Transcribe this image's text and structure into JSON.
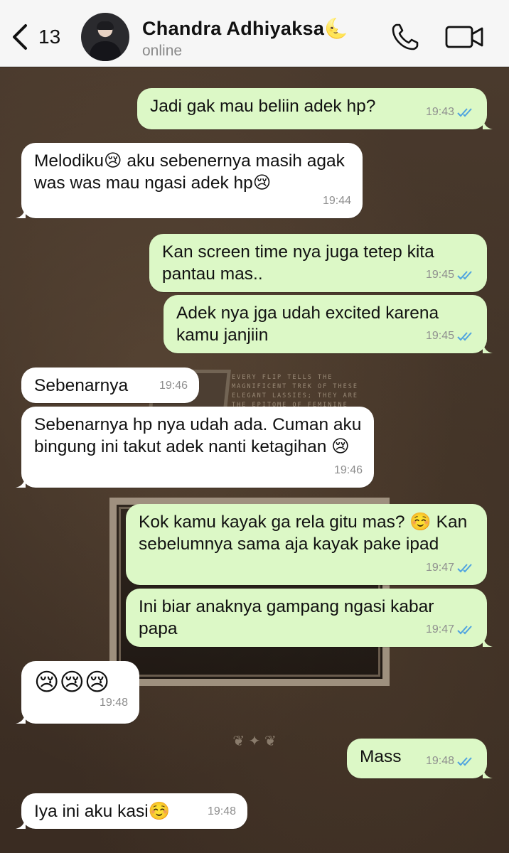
{
  "header": {
    "back_count": "13",
    "contact_name": "Chandra Adhiyaksa🌜",
    "contact_status": "online"
  },
  "wallpaper": {
    "text": "EVERY FLIP TELLS THE MAGNIFICENT TREK OF THESE ELEGANT LASSIES; THEY ARE THE EPITOME OF FEMININE"
  },
  "messages": [
    {
      "dir": "out",
      "text": "Jadi gak mau beliin adek hp?",
      "time": "19:43",
      "read": true
    },
    {
      "dir": "in",
      "text": "Melodiku😢 aku sebenernya masih agak was was mau ngasi adek hp😢",
      "time": "19:44"
    },
    {
      "dir": "out",
      "text": "Kan screen time nya juga tetep kita pantau mas..",
      "time": "19:45",
      "read": true
    },
    {
      "dir": "out",
      "text": "Adek nya jga udah excited karena kamu janjiin",
      "time": "19:45",
      "read": true
    },
    {
      "dir": "in",
      "text": "Sebenarnya",
      "time": "19:46"
    },
    {
      "dir": "in",
      "text": "Sebenarnya hp nya udah ada. Cuman aku bingung ini takut adek nanti ketagihan 😢",
      "time": "19:46"
    },
    {
      "dir": "out",
      "text": "Kok kamu kayak ga rela gitu mas? ☺️ Kan sebelumnya sama aja kayak pake ipad",
      "time": "19:47",
      "read": true
    },
    {
      "dir": "out",
      "text": "Ini biar anaknya gampang ngasi kabar papa",
      "time": "19:47",
      "read": true
    },
    {
      "dir": "in",
      "text": "😢😢😢",
      "time": "19:48"
    },
    {
      "dir": "out",
      "text": "Mass",
      "time": "19:48",
      "read": true
    },
    {
      "dir": "in",
      "text": "Iya ini aku kasi☺️",
      "time": "19:48"
    }
  ],
  "colors": {
    "outgoing_bubble": "#dcf8c6",
    "incoming_bubble": "#ffffff",
    "read_ticks": "#4fa3e0"
  }
}
